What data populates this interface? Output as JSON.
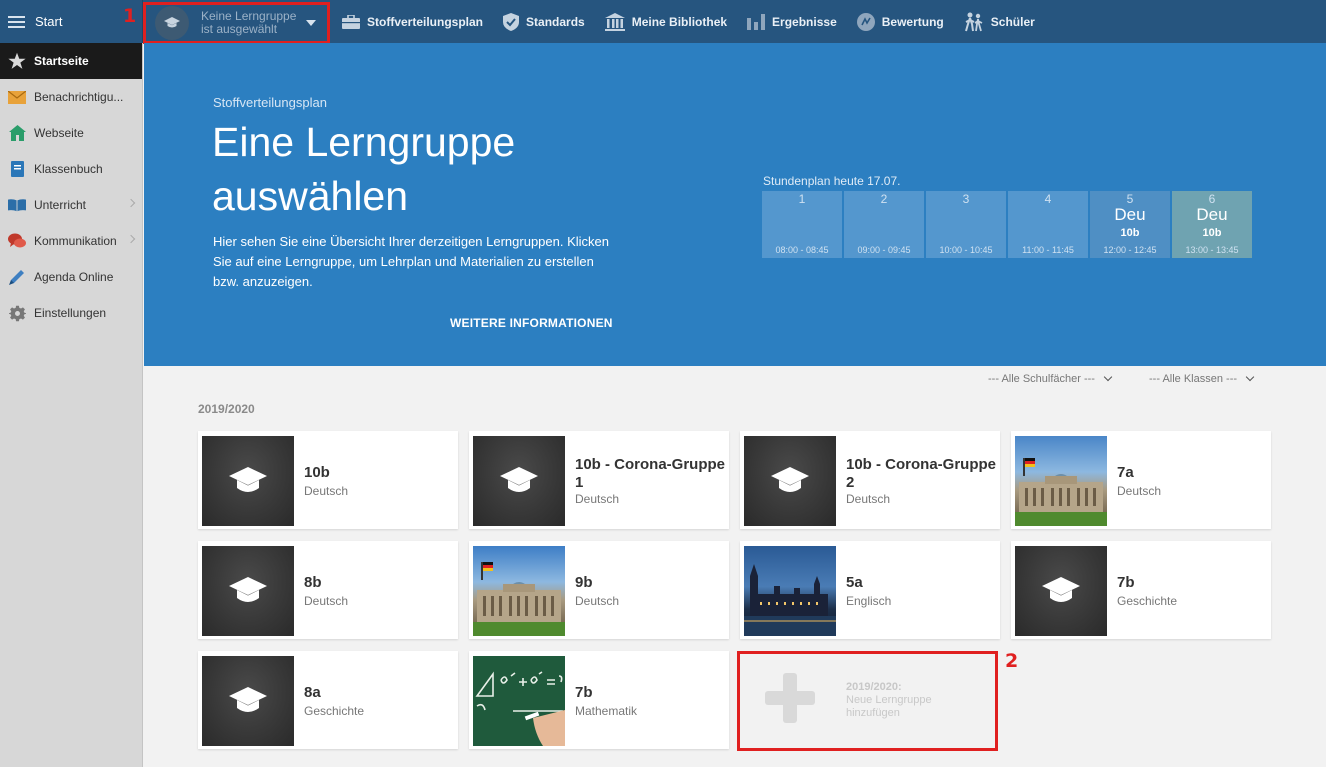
{
  "topbar": {
    "start_label": "Start",
    "group_select_line1": "Keine Lerngruppe",
    "group_select_line2": "ist ausgewählt",
    "nav": [
      {
        "label": "Stoffverteilungsplan",
        "icon": "briefcase-icon"
      },
      {
        "label": "Standards",
        "icon": "shield-check-icon"
      },
      {
        "label": "Meine Bibliothek",
        "icon": "library-icon"
      },
      {
        "label": "Ergebnisse",
        "icon": "bar-chart-icon"
      },
      {
        "label": "Bewertung",
        "icon": "rating-icon"
      },
      {
        "label": "Schüler",
        "icon": "students-icon"
      }
    ]
  },
  "annotations": {
    "marker1": "1",
    "marker2": "2",
    "color": "#e02020"
  },
  "sidebar": {
    "items": [
      {
        "label": "Startseite",
        "icon": "star-icon",
        "active": true
      },
      {
        "label": "Benachrichtigu...",
        "icon": "envelope-icon"
      },
      {
        "label": "Webseite",
        "icon": "home-icon"
      },
      {
        "label": "Klassenbuch",
        "icon": "book-icon"
      },
      {
        "label": "Unterricht",
        "icon": "open-book-icon",
        "chevron": true
      },
      {
        "label": "Kommunikation",
        "icon": "chat-icon",
        "chevron": true
      },
      {
        "label": "Agenda Online",
        "icon": "pencil-icon"
      },
      {
        "label": "Einstellungen",
        "icon": "gear-icon"
      }
    ]
  },
  "hero": {
    "eyebrow": "Stoffverteilungsplan",
    "title": "Eine Lerngruppe auswählen",
    "description": "Hier sehen Sie eine Übersicht Ihrer derzeitigen Lerngruppen. Klicken Sie auf eine Lerngruppe, um Lehrplan und Materialien zu erstellen bzw. anzuzeigen.",
    "more_link": "WEITERE INFORMATIONEN",
    "color": "#2c7fc1"
  },
  "schedule": {
    "title": "Stundenplan heute 17.07.",
    "slots": [
      {
        "num": "1",
        "subject": "",
        "class": "",
        "time": "08:00 - 08:45"
      },
      {
        "num": "2",
        "subject": "",
        "class": "",
        "time": "09:00 - 09:45"
      },
      {
        "num": "3",
        "subject": "",
        "class": "",
        "time": "10:00 - 10:45"
      },
      {
        "num": "4",
        "subject": "",
        "class": "",
        "time": "11:00 - 11:45"
      },
      {
        "num": "5",
        "subject": "Deu",
        "class": "10b",
        "time": "12:00 - 12:45"
      },
      {
        "num": "6",
        "subject": "Deu",
        "class": "10b",
        "time": "13:00 - 13:45"
      }
    ]
  },
  "filters": {
    "subjects": "--- Alle Schulfächer ---",
    "classes": "--- Alle Klassen ---"
  },
  "year_label": "2019/2020",
  "groups": [
    {
      "name": "10b",
      "subject": "Deutsch",
      "image": "chalkboard"
    },
    {
      "name": "10b - Corona-Gruppe 1",
      "subject": "Deutsch",
      "image": "chalkboard"
    },
    {
      "name": "10b - Corona-Gruppe 2",
      "subject": "Deutsch",
      "image": "chalkboard"
    },
    {
      "name": "7a",
      "subject": "Deutsch",
      "image": "reichstag"
    },
    {
      "name": "8b",
      "subject": "Deutsch",
      "image": "chalkboard"
    },
    {
      "name": "9b",
      "subject": "Deutsch",
      "image": "reichstag"
    },
    {
      "name": "5a",
      "subject": "Englisch",
      "image": "london"
    },
    {
      "name": "7b",
      "subject": "Geschichte",
      "image": "chalkboard"
    },
    {
      "name": "8a",
      "subject": "Geschichte",
      "image": "chalkboard"
    },
    {
      "name": "7b",
      "subject": "Mathematik",
      "image": "math-board"
    }
  ],
  "add_group": {
    "line1": "2019/2020:",
    "line2": "Neue Lerngruppe",
    "line3": "hinzufügen"
  }
}
